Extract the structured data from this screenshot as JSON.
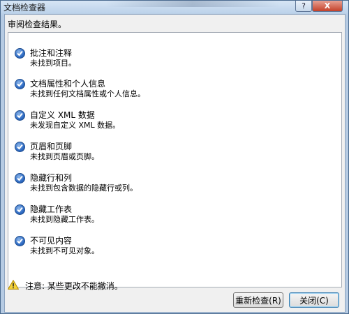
{
  "window": {
    "title": "文档检查器",
    "help_label": "?",
    "close_label": "X"
  },
  "heading": "审阅检查结果。",
  "results": [
    {
      "title": "批注和注释",
      "desc": "未找到项目。"
    },
    {
      "title": "文档属性和个人信息",
      "desc": "未找到任何文档属性或个人信息。"
    },
    {
      "title": "自定义 XML 数据",
      "desc": "未发现自定义 XML 数据。"
    },
    {
      "title": "页眉和页脚",
      "desc": "未找到页眉或页脚。"
    },
    {
      "title": "隐藏行和列",
      "desc": "未找到包含数据的隐藏行或列。"
    },
    {
      "title": "隐藏工作表",
      "desc": "未找到隐藏工作表。"
    },
    {
      "title": "不可见内容",
      "desc": "未找到不可见对象。"
    }
  ],
  "footer": {
    "warning": "注意: 某些更改不能撤消。"
  },
  "buttons": {
    "reinspect": "重新检查(R)",
    "close": "关闭(C)"
  },
  "colors": {
    "check": "#2f6cc4",
    "warning": "#e8b800",
    "close_button": "#c4412a"
  }
}
